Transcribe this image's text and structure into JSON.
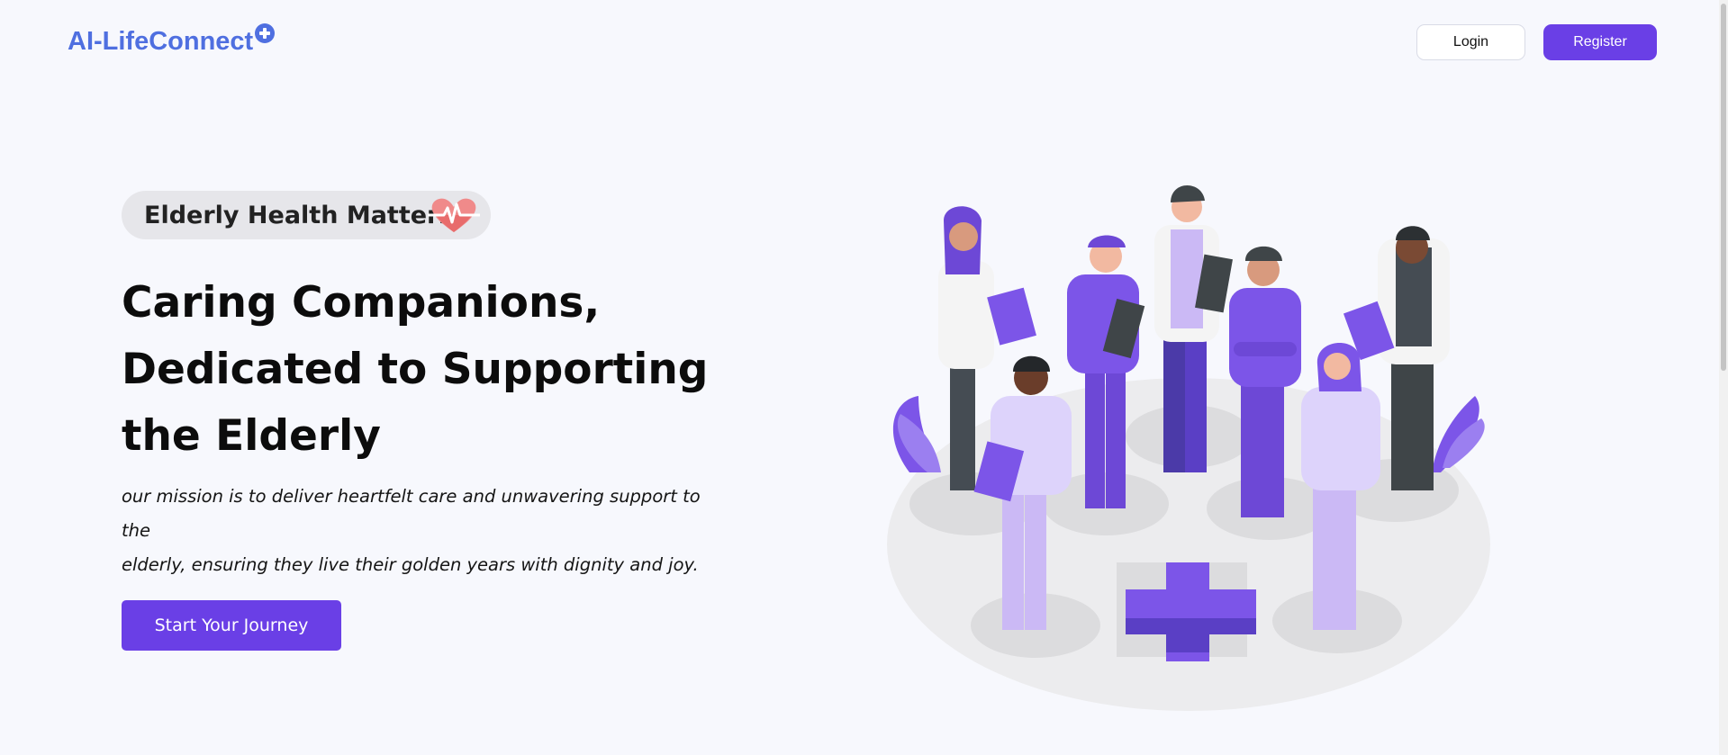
{
  "header": {
    "logo_text": "AI-LifeConnect",
    "login_label": "Login",
    "register_label": "Register"
  },
  "hero": {
    "badge_text": "Elderly Health Matters",
    "headline_lines": [
      "Caring Companions,",
      "Dedicated to Supporting",
      "the Elderly"
    ],
    "mission_lines": [
      "our mission is to deliver heartfelt care and unwavering support to the",
      "elderly, ensuring they live their golden years with dignity and joy."
    ],
    "cta_label": "Start Your Journey"
  },
  "colors": {
    "accent": "#6a3fe6",
    "logo": "#4f6fe0",
    "background": "#f7f8fd",
    "heart": "#f08a8a"
  },
  "icons": {
    "logo_badge": "plus-circle-icon",
    "badge_icon": "heart-pulse-icon",
    "illustration": "medical-team-illustration"
  }
}
